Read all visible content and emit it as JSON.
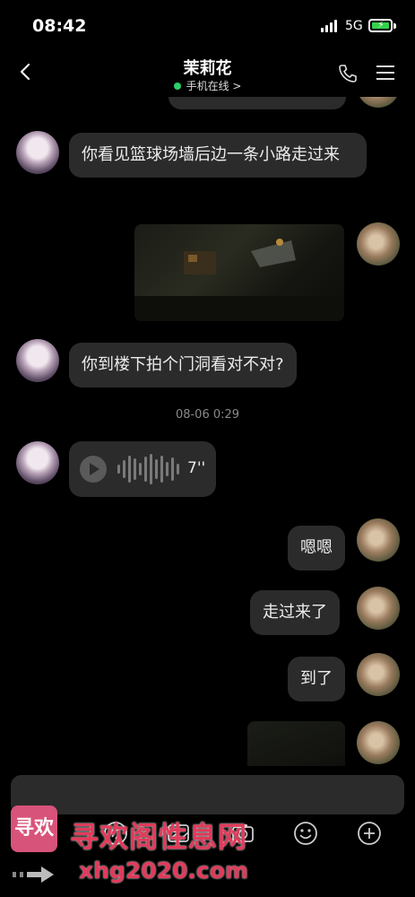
{
  "status": {
    "time": "08:42",
    "network": "5G"
  },
  "header": {
    "contact_name": "茉莉花",
    "presence": "手机在线 >"
  },
  "messages": [
    {
      "side": "them",
      "type": "text",
      "text": "你看见篮球场墙后边一条小路走过来"
    },
    {
      "side": "me",
      "type": "image"
    },
    {
      "side": "them",
      "type": "text",
      "text": "你到楼下拍个门洞看对不对?"
    },
    {
      "type": "timestamp",
      "text": "08-06 0:29"
    },
    {
      "side": "them",
      "type": "voice",
      "duration": "7''"
    },
    {
      "side": "me",
      "type": "text",
      "text": "嗯嗯"
    },
    {
      "side": "me",
      "type": "text",
      "text": "走过来了"
    },
    {
      "side": "me",
      "type": "text",
      "text": "到了"
    },
    {
      "side": "me",
      "type": "image"
    }
  ],
  "watermark": {
    "logo": "寻欢",
    "site": "寻欢阁性息网",
    "url": "xhg2020.com"
  },
  "colors": {
    "bubble": "#2b2b2b",
    "background": "#000000",
    "online": "#2bd06a",
    "watermark": "#e23a5a"
  }
}
